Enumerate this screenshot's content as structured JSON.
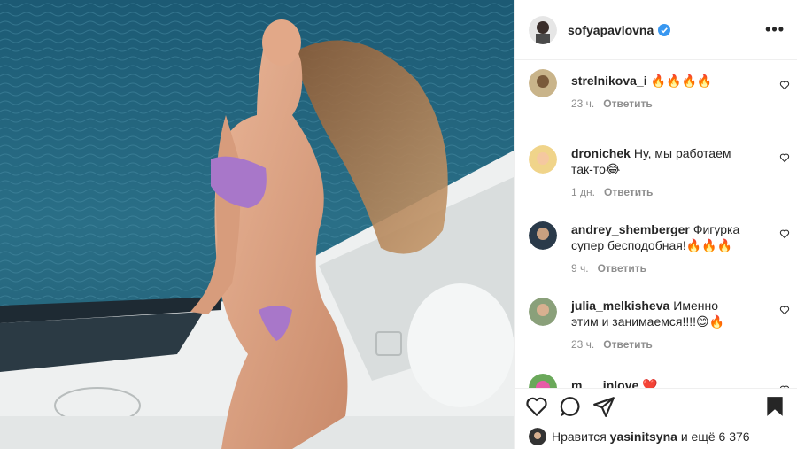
{
  "post": {
    "author": "sofyapavlovna",
    "more_icon": "more-horizontal-icon",
    "accent": "#3897f0"
  },
  "comments": [
    {
      "user": "strelnikova_i",
      "text": "🔥🔥🔥🔥",
      "time": "23 ч.",
      "reply": "Ответить"
    },
    {
      "user": "dronichek",
      "text": "Ну, мы работаем так-то😂",
      "time": "1 дн.",
      "reply": "Ответить"
    },
    {
      "user": "andrey_shemberger",
      "text": "Фигурка супер бесподобная!🔥🔥🔥",
      "time": "9 ч.",
      "reply": "Ответить"
    },
    {
      "user": "julia_melkisheva",
      "text": "Именно этим и занимаемся!!!!😊🔥",
      "time": "23 ч.",
      "reply": "Ответить"
    },
    {
      "user": "m___inlove",
      "text": "❤️",
      "time": "",
      "reply": ""
    }
  ],
  "likes": {
    "prefix": "Нравится",
    "user": "yasinitsyna",
    "suffix": "и ещё 6 376"
  }
}
